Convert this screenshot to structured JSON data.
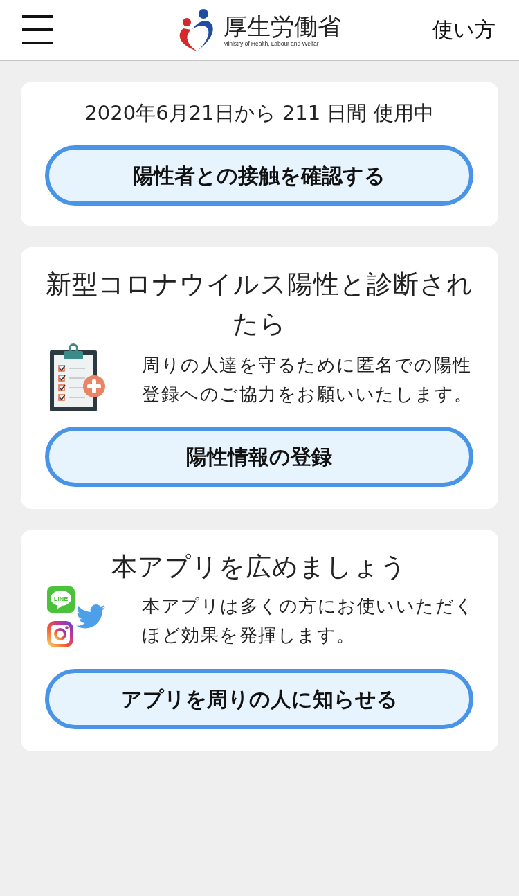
{
  "header": {
    "logo_title": "厚生労働省",
    "logo_subtitle": "Ministry of Health, Labour and Welfar",
    "help_link": "使い方"
  },
  "cards": [
    {
      "kind": "usage",
      "text": "2020年6月21日から 211 日間 使用中",
      "button": "陽性者との接触を確認する"
    },
    {
      "kind": "positive",
      "title": "新型コロナウイルス陽性と診断されたら",
      "body": "周りの人達を守るために匿名での陽性登録へのご協力をお願いいたします。",
      "button": "陽性情報の登録"
    },
    {
      "kind": "share",
      "title": "本アプリを広めましょう",
      "line_logo_text": "LINE",
      "body": "本アプリは多くの方にお使いいただくほど効果を発揮します。",
      "button": "アプリを周りの人に知らせる"
    }
  ]
}
